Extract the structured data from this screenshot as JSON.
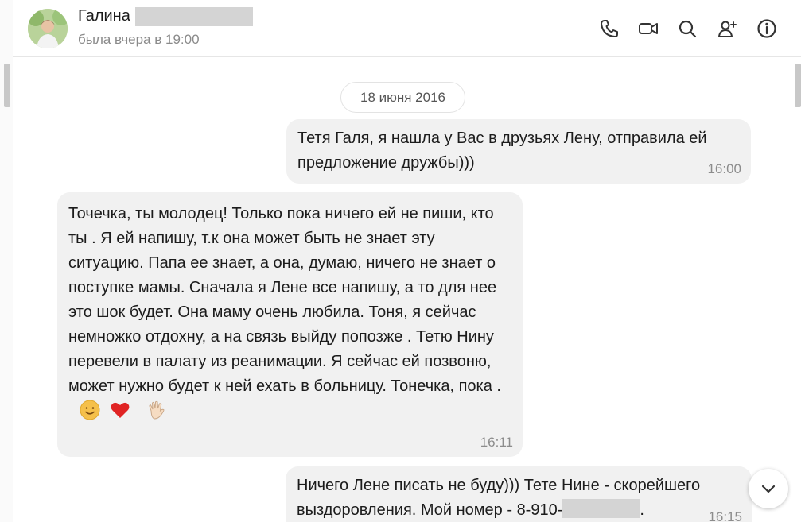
{
  "header": {
    "contact_name": "Галина",
    "status": "была вчера в 19:00",
    "icons": [
      "phone-icon",
      "video-call-icon",
      "search-icon",
      "add-user-icon",
      "info-icon"
    ]
  },
  "chat": {
    "date_separator": "18 июня 2016",
    "messages": [
      {
        "direction": "outgoing",
        "text": "Тетя Галя, я нашла у Вас в друзьях Лену, отправила ей предложение дружбы)))",
        "time": "16:00"
      },
      {
        "direction": "incoming",
        "text": "Точечка, ты молодец! Только пока ничего ей не пиши, кто ты . Я ей напишу, т.к она может быть не знает эту ситуацию. Папа ее знает, а она, думаю, ничего не знает о поступке мамы. Сначала я Лене все напишу, а то для нее это шок будет. Она маму очень любила. Тоня, я сейчас немножко отдохну, а на связь выйду попозже . Тетю Нину перевели в палату из реанимации. Я сейчас ей позвоню, может нужно будет к ней ехать в больницу. Тонечка, пока .",
        "emojis": [
          "smile-emoji",
          "red-heart-emoji",
          "waving-hand-emoji"
        ],
        "time": "16:11"
      },
      {
        "direction": "outgoing",
        "text_before_redaction": "Ничего Лене писать не буду))) Тете Нине - скорейшего выздоровления. Мой номер - 8-910-",
        "text_after_redaction": ".",
        "time": "16:15"
      }
    ]
  },
  "colors": {
    "bubble_bg": "#f1f1f1",
    "timestamp": "#8c8c8c",
    "status_text": "#8a8a8a",
    "redaction": "#d4d4d4"
  }
}
